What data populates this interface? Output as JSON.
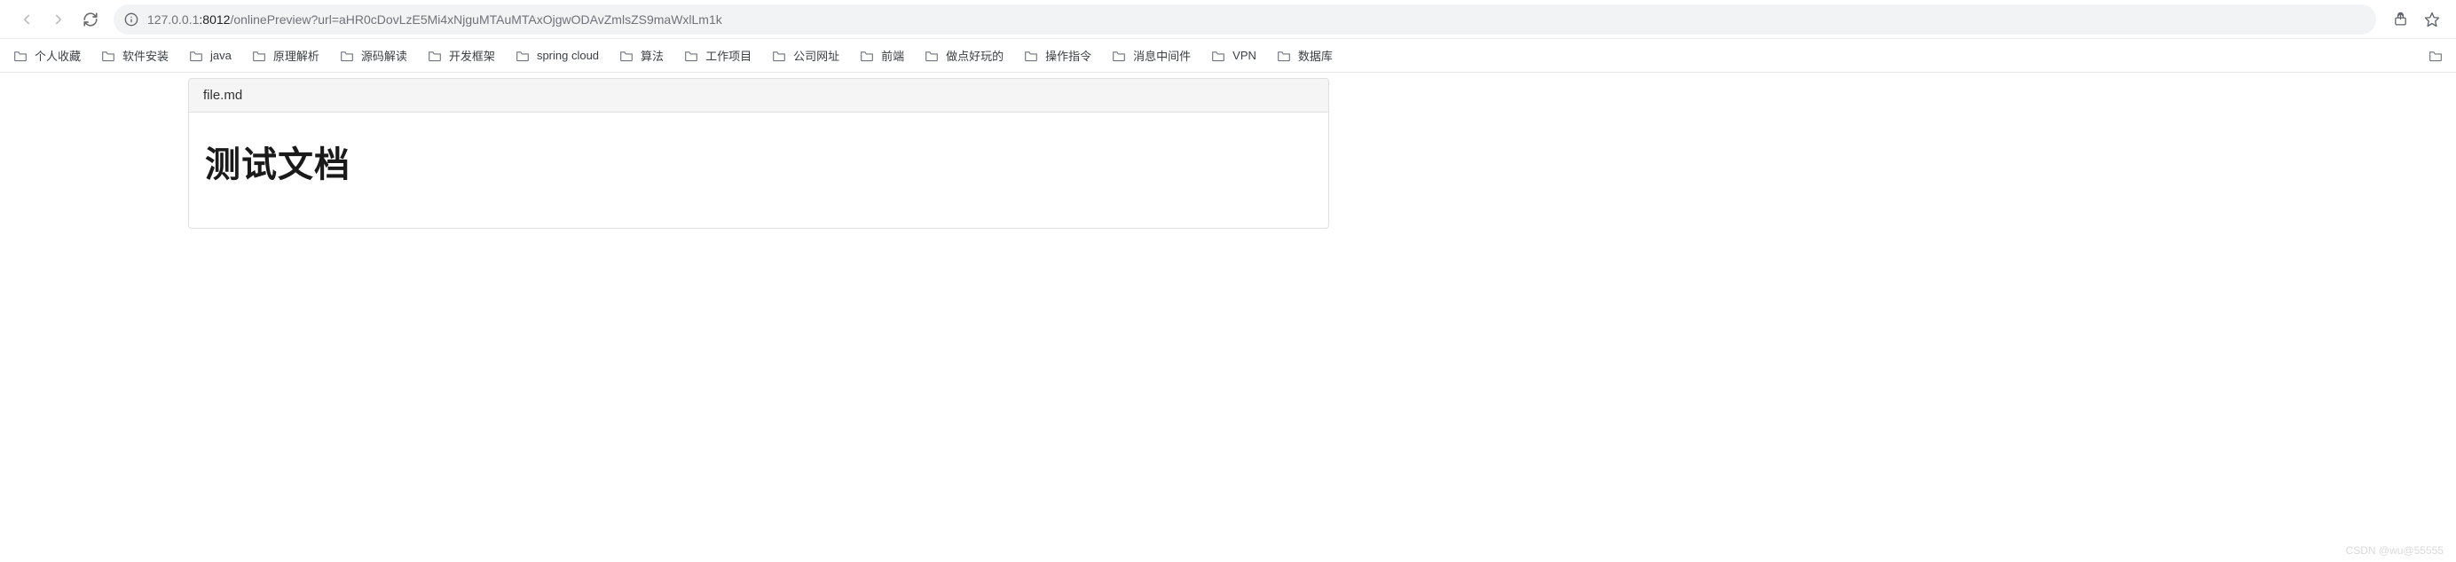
{
  "address": {
    "host_dim": "127.0.0.1",
    "port": ":8012",
    "path": "/onlinePreview?url=aHR0cDovLzE5Mi4xNjguMTAuMTAxOjgwODAvZmlsZS9maWxlLm1k"
  },
  "bookmarks": [
    {
      "label": "个人收藏"
    },
    {
      "label": "软件安装"
    },
    {
      "label": "java"
    },
    {
      "label": "原理解析"
    },
    {
      "label": "源码解读"
    },
    {
      "label": "开发框架"
    },
    {
      "label": "spring cloud"
    },
    {
      "label": "算法"
    },
    {
      "label": "工作项目"
    },
    {
      "label": "公司网址"
    },
    {
      "label": "前端"
    },
    {
      "label": "做点好玩的"
    },
    {
      "label": "操作指令"
    },
    {
      "label": "消息中间件"
    },
    {
      "label": "VPN"
    },
    {
      "label": "数据库"
    }
  ],
  "doc": {
    "filename": "file.md",
    "heading": "测试文档"
  },
  "watermark": "CSDN @wu@55555"
}
